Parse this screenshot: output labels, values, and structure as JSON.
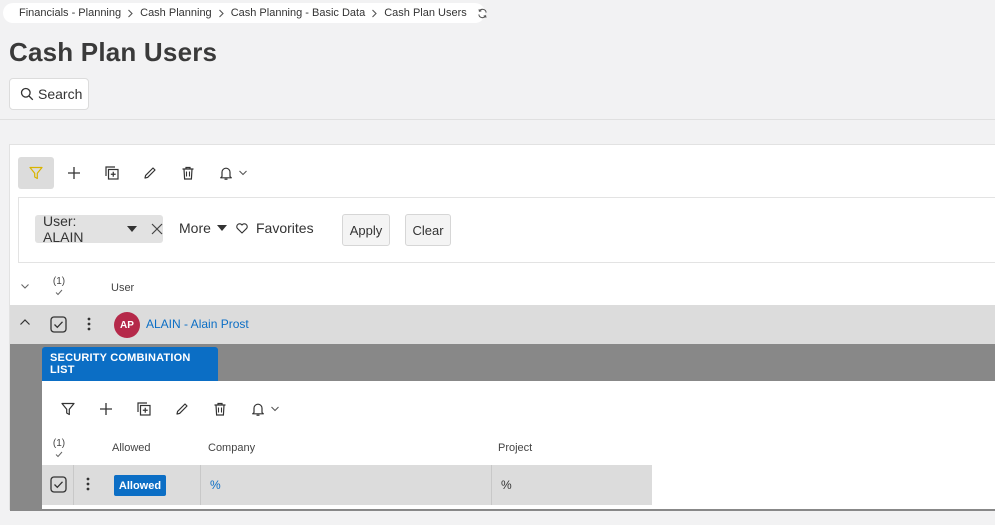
{
  "breadcrumb": {
    "items": [
      "Financials - Planning",
      "Cash Planning",
      "Cash Planning - Basic Data",
      "Cash Plan Users"
    ]
  },
  "page": {
    "title": "Cash Plan Users"
  },
  "search": {
    "label": "Search"
  },
  "filter": {
    "chip_label": "User: ALAIN",
    "more_label": "More",
    "favorites_label": "Favorites",
    "apply_label": "Apply",
    "clear_label": "Clear"
  },
  "table": {
    "selected_count": "(1)",
    "columns": [
      "User"
    ],
    "rows": [
      {
        "avatar_initials": "AP",
        "user": "ALAIN - Alain Prost"
      }
    ]
  },
  "detail": {
    "tab_label": "SECURITY COMBINATION LIST",
    "selected_count": "(1)",
    "columns": [
      "Allowed",
      "Company",
      "Project"
    ],
    "rows": [
      {
        "allowed": "Allowed",
        "company": "%",
        "project": "%"
      }
    ]
  },
  "colors": {
    "accent": "#0b6ec5",
    "avatar": "#b5294a",
    "row_selected": "#dcdcdc",
    "detail_bg": "#888888"
  }
}
